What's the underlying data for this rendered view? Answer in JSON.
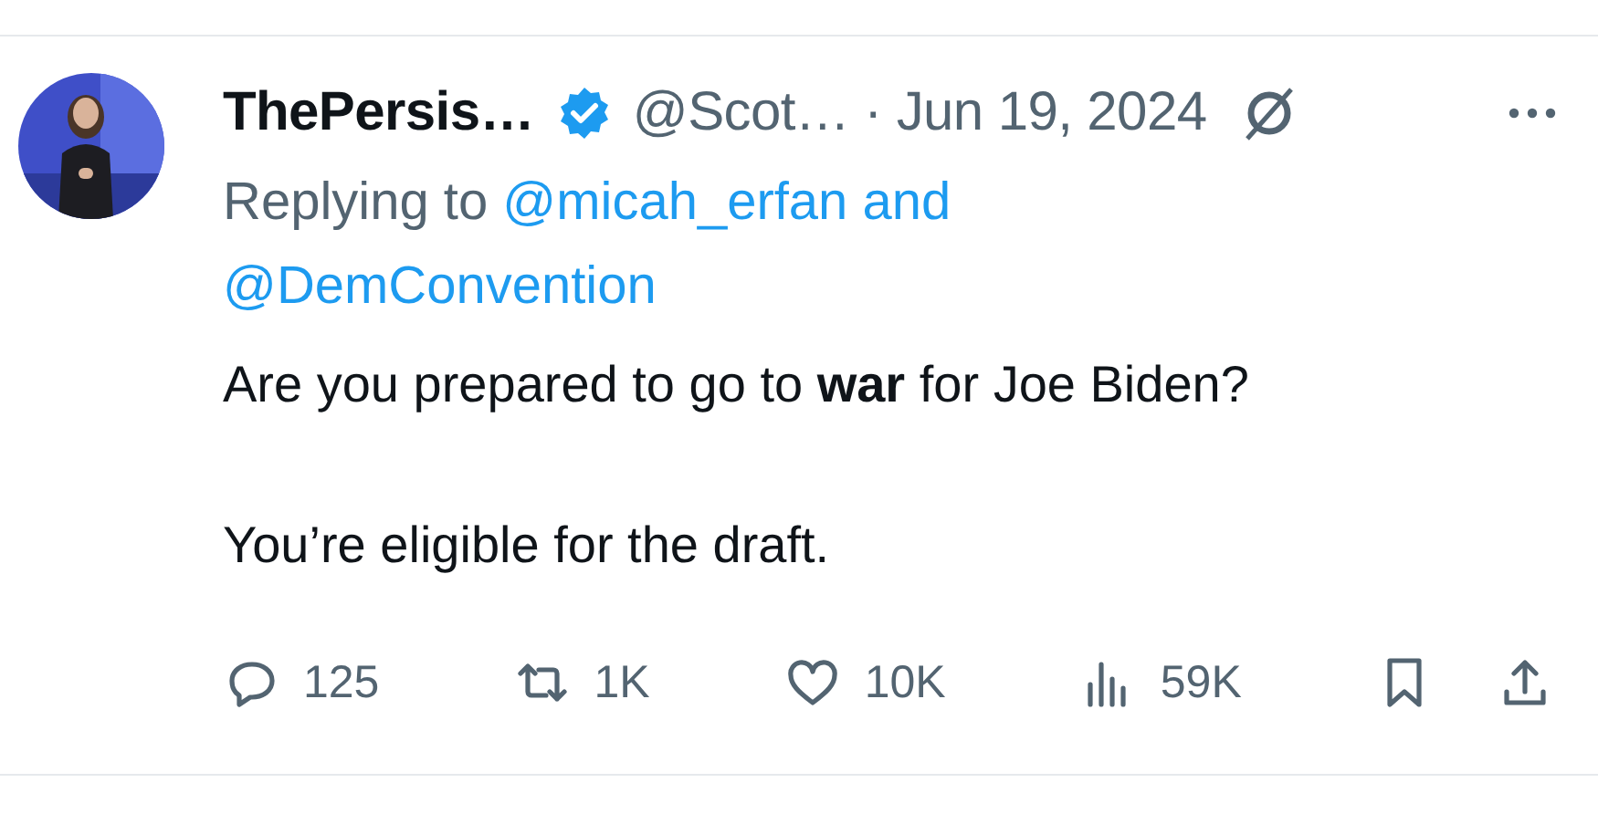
{
  "tweet": {
    "author": {
      "display_name": "ThePersis…",
      "verified": true,
      "handle": "@Scot…",
      "date": "· Jun 19, 2024"
    },
    "reply_to": {
      "prefix": "Replying to",
      "mentions": [
        "@micah_erfan",
        "@DemConvention"
      ],
      "joiner": "and"
    },
    "paragraphs": [
      "Are you prepared to go to **war** for Joe Biden?",
      "You’re eligible for the draft."
    ],
    "actions": [
      {
        "kind": "reply",
        "count": "125"
      },
      {
        "kind": "repost",
        "count": "1K"
      },
      {
        "kind": "like",
        "count": "10K"
      },
      {
        "kind": "views",
        "count": "59K"
      },
      {
        "kind": "bookmark"
      },
      {
        "kind": "share"
      }
    ]
  }
}
